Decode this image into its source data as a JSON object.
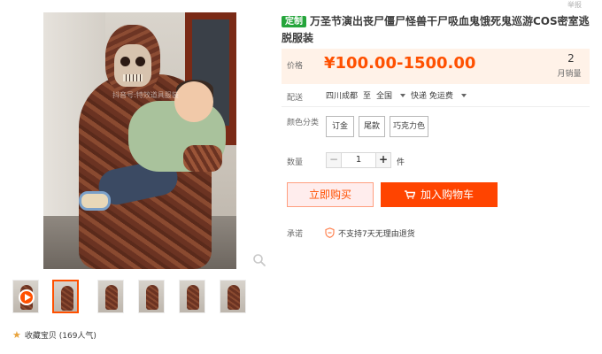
{
  "top_right_tag": "举报",
  "product": {
    "badge": "定制",
    "title": "万圣节演出丧尸僵尸怪兽干尸吸血鬼饿死鬼巡游COS密室逃脱服装",
    "main_image_watermark": "抖音号:特效道具服装",
    "price_label": "价格",
    "price": "¥100.00-1500.00",
    "sales_count": "2",
    "sales_label": "月销量"
  },
  "shipping": {
    "label": "配送",
    "origin": "四川成都",
    "to_word": "至",
    "destination": "全国",
    "method": "快递 免运费"
  },
  "color": {
    "label": "颜色分类",
    "options": [
      "订金",
      "尾款",
      "巧克力色"
    ]
  },
  "quantity": {
    "label": "数量",
    "minus": "−",
    "value": "1",
    "plus": "+",
    "unit": "件"
  },
  "actions": {
    "buy_now": "立即购买",
    "add_to_cart": "加入购物车"
  },
  "promise": {
    "label": "承诺",
    "text": "不支持7天无理由退货"
  },
  "favorite": {
    "text": "收藏宝贝 (169人气)"
  },
  "colors": {
    "accent": "#ff5000",
    "cart_button": "#ff4400",
    "badge_green": "#25a53b",
    "price_bg": "#fff2e8"
  },
  "icons": [
    "play-icon",
    "zoom-icon",
    "star-icon",
    "cart-icon",
    "shield-icon",
    "chevron-down-icon"
  ]
}
